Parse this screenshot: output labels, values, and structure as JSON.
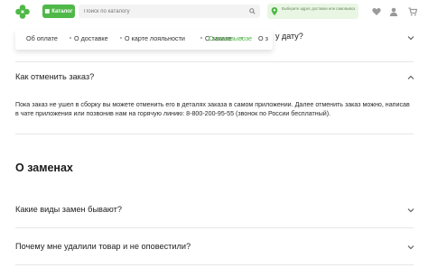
{
  "header": {
    "catalog_label": "Каталог",
    "search_placeholder": "Поиск по каталогу",
    "delivery_text": "Выберите адрес доставки или самовывоз"
  },
  "nav_tabs": [
    {
      "label": "Об оплате"
    },
    {
      "label": "О доставке"
    },
    {
      "label": "О карте лояльности"
    },
    {
      "label": "О заказе"
    },
    {
      "label": "О самовывозе"
    },
    {
      "label": "О з"
    }
  ],
  "faq": {
    "partial_question": "у дату?",
    "q_cancel": "Как отменить заказ?",
    "a_cancel": "Пока заказ не ушел в сборку вы можете отменить его в деталях заказа в самом приложении. Далее отменить заказ можно, написав в чате приложения или позвонив нам на горячую линию: 8-800-200-95-55 (звонок по России бесплатный).",
    "section_replacements": "О заменах",
    "q_types": "Какие виды замен бывают?",
    "q_removed": "Почему мне удалили товар и не оповестили?"
  },
  "colors": {
    "brand_green": "#4fb848",
    "delivery_bg": "#e9f6e4"
  }
}
